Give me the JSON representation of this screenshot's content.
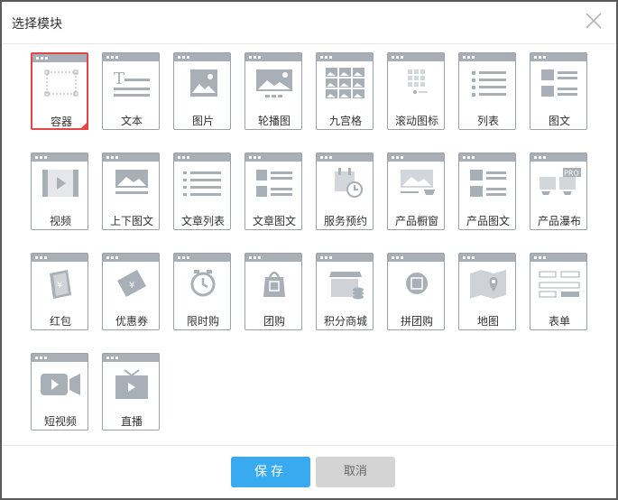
{
  "dialog": {
    "title": "选择模块",
    "close_icon": "close-icon"
  },
  "modules": [
    {
      "label": "容器",
      "icon": "container-icon",
      "selected": true
    },
    {
      "label": "文本",
      "icon": "text-icon"
    },
    {
      "label": "图片",
      "icon": "image-icon"
    },
    {
      "label": "轮播图",
      "icon": "carousel-icon"
    },
    {
      "label": "九宫格",
      "icon": "grid-icon"
    },
    {
      "label": "滚动图标",
      "icon": "scroll-icons-icon"
    },
    {
      "label": "列表",
      "icon": "list-icon"
    },
    {
      "label": "图文",
      "icon": "image-text-icon"
    },
    {
      "label": "视频",
      "icon": "video-icon"
    },
    {
      "label": "上下图文",
      "icon": "top-bottom-image-text-icon"
    },
    {
      "label": "文章列表",
      "icon": "article-list-icon"
    },
    {
      "label": "文章图文",
      "icon": "article-image-text-icon"
    },
    {
      "label": "服务预约",
      "icon": "service-booking-icon"
    },
    {
      "label": "产品橱窗",
      "icon": "product-showcase-icon"
    },
    {
      "label": "产品图文",
      "icon": "product-image-text-icon"
    },
    {
      "label": "产品瀑布",
      "icon": "product-waterfall-icon"
    },
    {
      "label": "红包",
      "icon": "red-packet-icon"
    },
    {
      "label": "优惠券",
      "icon": "coupon-icon"
    },
    {
      "label": "限时购",
      "icon": "flash-sale-icon"
    },
    {
      "label": "团购",
      "icon": "group-buy-icon"
    },
    {
      "label": "积分商城",
      "icon": "points-mall-icon"
    },
    {
      "label": "拼团购",
      "icon": "team-buy-icon"
    },
    {
      "label": "地图",
      "icon": "map-icon"
    },
    {
      "label": "表单",
      "icon": "form-icon"
    },
    {
      "label": "短视频",
      "icon": "short-video-icon"
    },
    {
      "label": "直播",
      "icon": "live-icon"
    }
  ],
  "footer": {
    "save_label": "保存",
    "cancel_label": "取消"
  },
  "colors": {
    "accent": "#39aaf0",
    "selected": "#e64545",
    "icon_gray": "#a8afb6"
  }
}
